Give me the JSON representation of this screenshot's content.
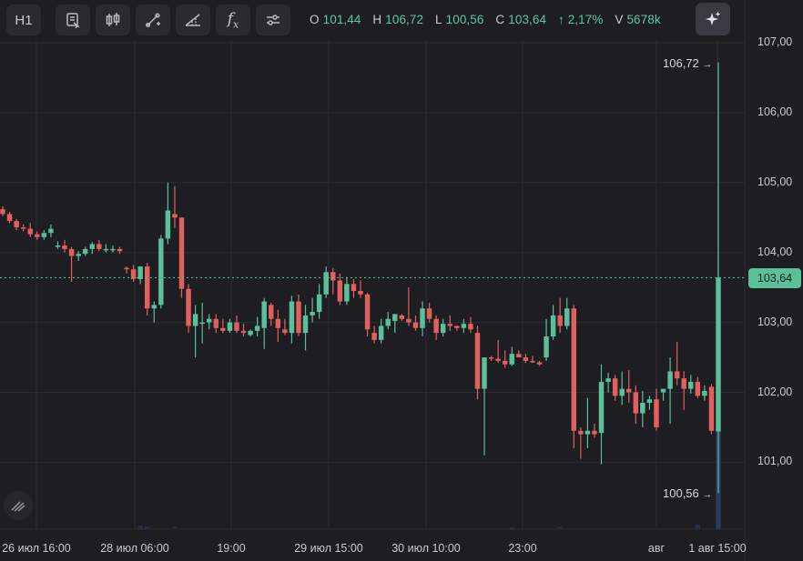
{
  "toolbar": {
    "interval_label": "H1",
    "icons": [
      "indicator-template-icon",
      "candles-icon",
      "draw-line-icon",
      "draw-ray-icon",
      "function-icon",
      "settings-sliders-icon"
    ],
    "ai_icon": "sparkle-icon"
  },
  "ohlc": {
    "o_label": "O",
    "o_value": "101,44",
    "h_label": "H",
    "h_value": "106,72",
    "l_label": "L",
    "l_value": "100,56",
    "c_label": "C",
    "c_value": "103,64",
    "change": "↑ 2,17%",
    "v_label": "V",
    "v_value": "5678k"
  },
  "current_price": "103,64",
  "high_marker": "106,72",
  "low_marker": "100,56",
  "colors": {
    "up": "#5bbf9a",
    "down": "#e0605f",
    "grid": "#2c2c33",
    "bg": "#1e1e22"
  },
  "chart_data": {
    "type": "candlestick",
    "y_ticks": [
      "107,00",
      "106,00",
      "105,00",
      "104,00",
      "103,00",
      "102,00",
      "101,00"
    ],
    "y_tick_values": [
      107,
      106,
      105,
      104,
      103,
      102,
      101
    ],
    "ylim": [
      100.1,
      107.6
    ],
    "x_tick_labels": [
      "26 июл 16:00",
      "28 июл 06:00",
      "19:00",
      "29 июл 15:00",
      "30 июл 10:00",
      "23:00",
      "авг",
      "1 авг 15:00"
    ],
    "current_price": 103.64,
    "candles": [
      [
        104.62,
        104.66,
        104.52,
        104.55
      ],
      [
        104.55,
        104.58,
        104.42,
        104.45
      ],
      [
        104.45,
        104.48,
        104.32,
        104.36
      ],
      [
        104.36,
        104.4,
        104.3,
        104.34
      ],
      [
        104.34,
        104.42,
        104.22,
        104.26
      ],
      [
        104.26,
        104.3,
        104.18,
        104.22
      ],
      [
        104.22,
        104.32,
        104.18,
        104.28
      ],
      [
        104.28,
        104.4,
        104.22,
        104.34
      ],
      [
        104.1,
        104.16,
        104.05,
        104.1
      ],
      [
        104.1,
        104.18,
        104.0,
        104.05
      ],
      [
        104.05,
        104.08,
        103.58,
        103.95
      ],
      [
        103.95,
        104.02,
        103.88,
        103.98
      ],
      [
        103.98,
        104.08,
        103.95,
        104.05
      ],
      [
        104.05,
        104.15,
        103.98,
        104.12
      ],
      [
        104.12,
        104.18,
        104.02,
        104.05
      ],
      [
        104.05,
        104.12,
        104.0,
        104.05
      ],
      [
        104.05,
        104.1,
        104.0,
        104.05
      ],
      [
        104.05,
        104.08,
        103.98,
        104.02
      ],
      [
        103.78,
        103.8,
        103.7,
        103.76
      ],
      [
        103.76,
        103.82,
        103.58,
        103.62
      ],
      [
        103.62,
        103.7,
        103.55,
        103.8
      ],
      [
        103.8,
        103.85,
        103.1,
        103.2
      ],
      [
        103.2,
        103.3,
        103.0,
        103.25
      ],
      [
        103.25,
        104.25,
        103.2,
        104.2
      ],
      [
        104.2,
        105.0,
        104.12,
        104.6
      ],
      [
        104.55,
        104.95,
        104.35,
        104.5
      ],
      [
        104.5,
        104.5,
        103.35,
        103.48
      ],
      [
        103.48,
        103.55,
        102.85,
        102.95
      ],
      [
        102.95,
        103.25,
        102.5,
        103.12
      ],
      [
        102.98,
        103.28,
        102.7,
        103.0
      ],
      [
        103.0,
        103.12,
        102.9,
        103.05
      ],
      [
        103.05,
        103.12,
        102.85,
        102.92
      ],
      [
        102.92,
        103.05,
        102.85,
        102.88
      ],
      [
        102.88,
        103.05,
        102.85,
        103.0
      ],
      [
        103.0,
        103.1,
        102.85,
        102.88
      ],
      [
        102.88,
        102.98,
        102.8,
        102.85
      ],
      [
        102.82,
        102.9,
        102.8,
        102.88
      ],
      [
        102.88,
        103.08,
        102.8,
        102.95
      ],
      [
        102.92,
        103.35,
        102.62,
        103.3
      ],
      [
        103.25,
        103.28,
        102.95,
        103.05
      ],
      [
        103.05,
        103.18,
        102.72,
        102.92
      ],
      [
        102.9,
        103.05,
        102.82,
        102.85
      ],
      [
        102.85,
        103.38,
        102.7,
        103.3
      ],
      [
        103.3,
        103.4,
        102.8,
        102.85
      ],
      [
        102.85,
        103.25,
        102.6,
        103.1
      ],
      [
        103.1,
        103.35,
        103.0,
        103.15
      ],
      [
        103.15,
        103.55,
        103.05,
        103.4
      ],
      [
        103.4,
        103.8,
        103.35,
        103.72
      ],
      [
        103.72,
        103.78,
        103.4,
        103.6
      ],
      [
        103.6,
        103.7,
        103.25,
        103.3
      ],
      [
        103.3,
        103.65,
        103.25,
        103.55
      ],
      [
        103.55,
        103.62,
        103.35,
        103.45
      ],
      [
        103.45,
        103.6,
        103.35,
        103.4
      ],
      [
        103.4,
        103.42,
        102.8,
        102.9
      ],
      [
        102.85,
        102.95,
        102.7,
        102.75
      ],
      [
        102.75,
        103.05,
        102.7,
        102.95
      ],
      [
        102.95,
        103.15,
        102.9,
        103.05
      ],
      [
        103.02,
        103.1,
        102.85,
        103.12
      ],
      [
        103.1,
        103.12,
        103.02,
        103.05
      ],
      [
        103.05,
        103.5,
        102.95,
        103.0
      ],
      [
        103.0,
        103.1,
        102.88,
        102.92
      ],
      [
        102.92,
        103.3,
        102.8,
        103.2
      ],
      [
        103.2,
        103.28,
        103.0,
        103.05
      ],
      [
        103.05,
        103.1,
        102.75,
        102.85
      ],
      [
        102.85,
        103.05,
        102.8,
        102.98
      ],
      [
        102.98,
        103.1,
        102.88,
        102.95
      ],
      [
        102.95,
        102.95,
        102.88,
        102.92
      ],
      [
        102.92,
        103.05,
        102.85,
        102.98
      ],
      [
        102.98,
        103.08,
        102.85,
        102.9
      ],
      [
        102.85,
        102.95,
        101.9,
        102.05
      ],
      [
        102.05,
        102.45,
        101.1,
        102.5
      ],
      [
        102.5,
        102.52,
        102.45,
        102.48
      ],
      [
        102.48,
        102.75,
        102.42,
        102.45
      ],
      [
        102.45,
        102.6,
        102.35,
        102.4
      ],
      [
        102.4,
        102.65,
        102.38,
        102.55
      ],
      [
        102.55,
        102.6,
        102.5,
        102.5
      ],
      [
        102.5,
        102.55,
        102.42,
        102.45
      ],
      [
        102.45,
        102.52,
        102.42,
        102.43
      ],
      [
        102.43,
        102.45,
        102.38,
        102.4
      ],
      [
        102.5,
        103.05,
        102.45,
        102.8
      ],
      [
        102.8,
        103.25,
        102.75,
        103.1
      ],
      [
        103.1,
        103.35,
        102.85,
        102.95
      ],
      [
        102.95,
        103.35,
        102.9,
        103.2
      ],
      [
        103.2,
        103.25,
        101.2,
        101.45
      ],
      [
        101.45,
        101.5,
        101.05,
        101.4
      ],
      [
        101.4,
        101.92,
        101.2,
        101.45
      ],
      [
        101.45,
        101.55,
        101.35,
        101.4
      ],
      [
        101.42,
        102.4,
        100.97,
        102.15
      ],
      [
        102.15,
        102.28,
        102.0,
        102.2
      ],
      [
        102.2,
        102.25,
        101.88,
        101.95
      ],
      [
        101.95,
        102.3,
        101.82,
        102.05
      ],
      [
        102.05,
        102.32,
        101.85,
        102.0
      ],
      [
        102.0,
        102.1,
        101.55,
        101.7
      ],
      [
        101.7,
        102.02,
        101.5,
        101.85
      ],
      [
        101.85,
        101.95,
        101.75,
        101.9
      ],
      [
        101.9,
        102.05,
        101.45,
        101.5
      ],
      [
        102.0,
        102.05,
        101.88,
        102.05
      ],
      [
        102.05,
        102.5,
        101.55,
        102.3
      ],
      [
        102.3,
        102.72,
        102.1,
        102.2
      ],
      [
        102.2,
        102.3,
        101.75,
        102.05
      ],
      [
        102.05,
        102.25,
        101.98,
        102.15
      ],
      [
        102.15,
        102.22,
        101.92,
        101.95
      ],
      [
        101.95,
        102.1,
        101.88,
        102.02
      ],
      [
        102.08,
        102.12,
        101.4,
        101.45
      ],
      [
        101.44,
        106.72,
        100.56,
        103.64
      ]
    ]
  }
}
